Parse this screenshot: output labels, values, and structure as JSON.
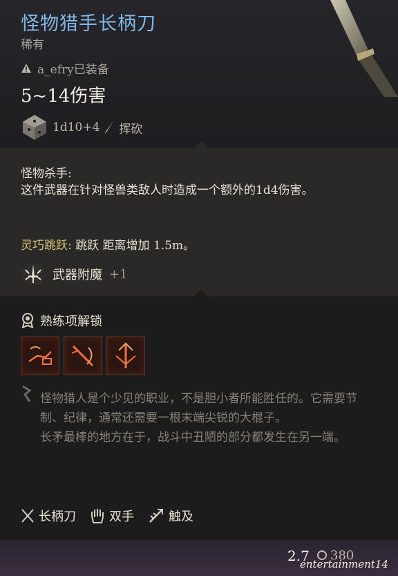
{
  "item": {
    "title": "怪物猎手长柄刀",
    "rarity": "稀有",
    "equipped_text": "a_efry已装备",
    "damage": "5~14伤害",
    "dice_formula": "1d10+4",
    "damage_type": "挥砍"
  },
  "passive": {
    "title": "怪物杀手:",
    "description": "这件武器在针对怪兽类敌人时造成一个额外的1d4伤害。"
  },
  "leap": {
    "name": "灵巧跳跃:",
    "text": " 跳跃 距离增加 1.5m。"
  },
  "enchantment": {
    "label": "武器附魔",
    "bonus": "+1"
  },
  "proficiency": {
    "heading": "熟练项解锁",
    "icons": [
      "pommel-strike-icon",
      "lacerate-icon",
      "piercing-strike-icon"
    ]
  },
  "lore": {
    "para1": "怪物猎人是个少见的职业，不是胆小者所能胜任的。它需要节制、纪律，通常还需要一根末端尖锐的大棍子。",
    "para2": "长矛最棒的地方在于，战斗中丑陋的部分都发生在另一端。"
  },
  "properties": [
    {
      "icon": "crossed-weapons-icon",
      "label": "长柄刀"
    },
    {
      "icon": "two-hand-icon",
      "label": "双手"
    },
    {
      "icon": "reach-icon",
      "label": "触及"
    }
  ],
  "footer": {
    "weight": "2.7",
    "price": "380",
    "watermark": "entertainment14"
  },
  "colors": {
    "title": "#7fb8e8",
    "leap_name": "#d6c47a",
    "lore_text": "#868178"
  }
}
